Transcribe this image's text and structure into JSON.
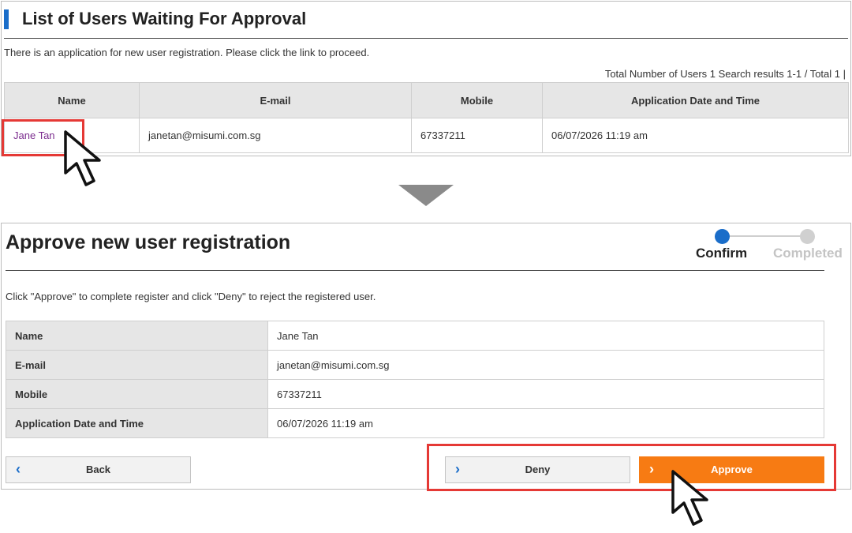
{
  "list_panel": {
    "title": "List of Users Waiting For Approval",
    "note": "There is an application for new user registration. Please click the link to proceed.",
    "summary": "Total Number of Users 1  Search results 1-1 / Total 1 |",
    "columns": [
      "Name",
      "E-mail",
      "Mobile",
      "Application Date and Time"
    ],
    "rows": [
      {
        "name": "Jane Tan",
        "email": "janetan@misumi.com.sg",
        "mobile": "67337211",
        "date": "06/07/2026 11:19 am"
      }
    ]
  },
  "approve_panel": {
    "title": "Approve new user registration",
    "note": "Click \"Approve\" to complete register and click \"Deny\" to reject the registered user.",
    "steps": [
      {
        "label": "Confirm",
        "active": true
      },
      {
        "label": "Completed",
        "active": false
      }
    ],
    "details": [
      {
        "label": "Name",
        "value": "Jane Tan"
      },
      {
        "label": "E-mail",
        "value": "janetan@misumi.com.sg"
      },
      {
        "label": "Mobile",
        "value": "67337211"
      },
      {
        "label": "Application Date and Time",
        "value": "06/07/2026 11:19 am"
      }
    ],
    "buttons": {
      "back": "Back",
      "deny": "Deny",
      "approve": "Approve"
    }
  },
  "icons": {
    "chevron_left": "‹",
    "chevron_right": "›",
    "cursor": "mouse-pointer-icon",
    "arrow": "down-arrow-icon"
  },
  "colors": {
    "accent_blue": "#1a6dc9",
    "approve_orange": "#f77b13",
    "highlight_red": "#e53935",
    "link_purple": "#7b2c8e"
  }
}
